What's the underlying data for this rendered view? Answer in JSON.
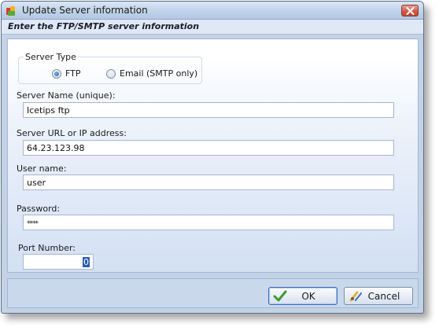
{
  "window": {
    "title": "Update Server information",
    "header": "Enter the FTP/SMTP server information"
  },
  "server_type": {
    "legend": "Server Type",
    "options": [
      {
        "label": "FTP",
        "selected": true
      },
      {
        "label": "Email (SMTP only)",
        "selected": false
      }
    ]
  },
  "fields": {
    "server_name": {
      "label": "Server Name (unique):",
      "value": "Icetips ftp"
    },
    "server_url": {
      "label": "Server URL or IP address:",
      "value": "64.23.123.98"
    },
    "user_name": {
      "label": "User name:",
      "value": "user"
    },
    "password": {
      "label": "Password:",
      "value": "****"
    },
    "port": {
      "label": "Port Number:",
      "value": "0"
    }
  },
  "buttons": {
    "ok": "OK",
    "cancel": "Cancel"
  },
  "colors": {
    "title_bar": "#c5d6ec",
    "close_button": "#cf5a47",
    "ok_icon": "#3f9a32",
    "selection": "#2d5fb0"
  },
  "icons": {
    "app": "app-logo-icon",
    "close": "close-icon",
    "ok": "checkmark-icon",
    "cancel": "cancel-icon"
  }
}
